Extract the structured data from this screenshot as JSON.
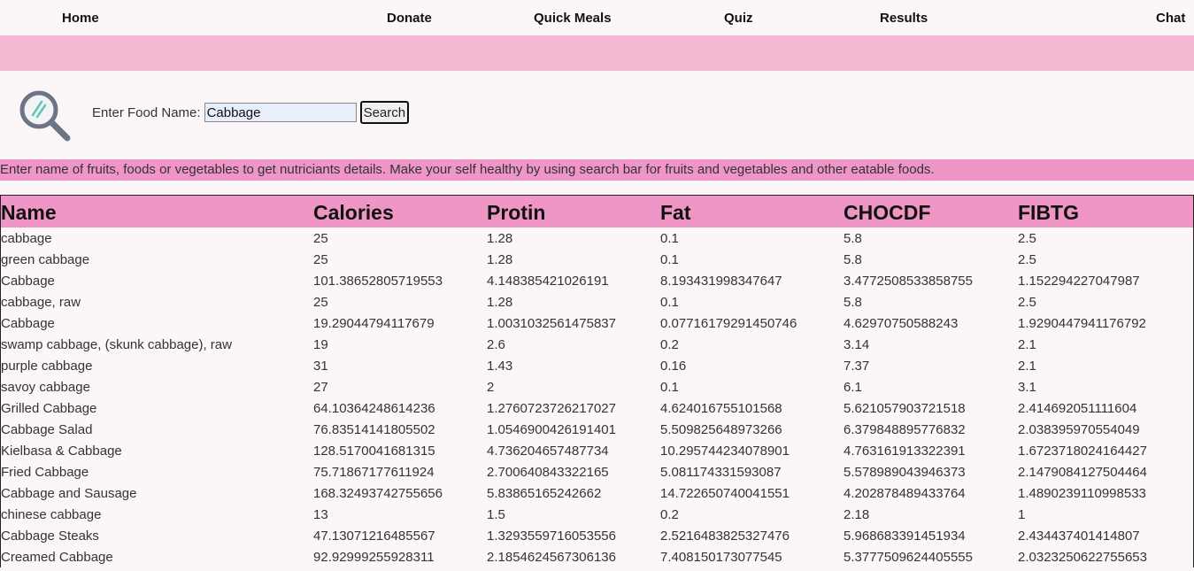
{
  "nav": {
    "home": "Home",
    "donate": "Donate",
    "quick_meals": "Quick Meals",
    "quiz": "Quiz",
    "results": "Results",
    "chat": "Chat"
  },
  "search": {
    "label": "Enter Food Name:",
    "value": "Cabbage",
    "button": "Search",
    "icon": "magnifier-icon"
  },
  "info_text": "Enter name of fruits, foods or vegetables to get nutriciants details. Make your self healthy by using search bar for fruits and vegetables and other eatable foods.",
  "table": {
    "headers": [
      "Name",
      "Calories",
      "Protin",
      "Fat",
      "CHOCDF",
      "FIBTG"
    ],
    "rows": [
      [
        "cabbage",
        "25",
        "1.28",
        "0.1",
        "5.8",
        "2.5"
      ],
      [
        "green cabbage",
        "25",
        "1.28",
        "0.1",
        "5.8",
        "2.5"
      ],
      [
        "Cabbage",
        "101.38652805719553",
        "4.148385421026191",
        "8.193431998347647",
        "3.4772508533858755",
        "1.152294227047987"
      ],
      [
        "cabbage, raw",
        "25",
        "1.28",
        "0.1",
        "5.8",
        "2.5"
      ],
      [
        "Cabbage",
        "19.29044794117679",
        "1.0031032561475837",
        "0.07716179291450746",
        "4.62970750588243",
        "1.9290447941176792"
      ],
      [
        "swamp cabbage, (skunk cabbage), raw",
        "19",
        "2.6",
        "0.2",
        "3.14",
        "2.1"
      ],
      [
        "purple cabbage",
        "31",
        "1.43",
        "0.16",
        "7.37",
        "2.1"
      ],
      [
        "savoy cabbage",
        "27",
        "2",
        "0.1",
        "6.1",
        "3.1"
      ],
      [
        "Grilled Cabbage",
        "64.10364248614236",
        "1.2760723726217027",
        "4.624016755101568",
        "5.621057903721518",
        "2.414692051111604"
      ],
      [
        "Cabbage Salad",
        "76.83514141805502",
        "1.0546900426191401",
        "5.509825648973266",
        "6.379848895776832",
        "2.038395970554049"
      ],
      [
        "Kielbasa & Cabbage",
        "128.5170041681315",
        "4.736204657487734",
        "10.295744234078901",
        "4.763161913322391",
        "1.6723718024164427"
      ],
      [
        "Fried Cabbage",
        "75.71867177611924",
        "2.700640843322165",
        "5.081174331593087",
        "5.578989043946373",
        "2.1479084127504464"
      ],
      [
        "Cabbage and Sausage",
        "168.32493742755656",
        "5.83865165242662",
        "14.722650740041551",
        "4.202878489433764",
        "1.4890239110998533"
      ],
      [
        "chinese cabbage",
        "13",
        "1.5",
        "0.2",
        "2.18",
        "1"
      ],
      [
        "Cabbage Steaks",
        "47.13071216485567",
        "1.3293559716053556",
        "2.5216483825327476",
        "5.968683391451934",
        "2.434437401414807"
      ],
      [
        "Creamed Cabbage",
        "92.92999255928311",
        "2.1854624567306136",
        "7.408150173077545",
        "5.3777509624405555",
        "2.0323250622755653"
      ]
    ]
  },
  "colors": {
    "page_bg": "#fdf6f9",
    "band_pink": "#f5b8d3",
    "accent_pink": "#ef96c6",
    "input_bg": "#e8eefb"
  }
}
